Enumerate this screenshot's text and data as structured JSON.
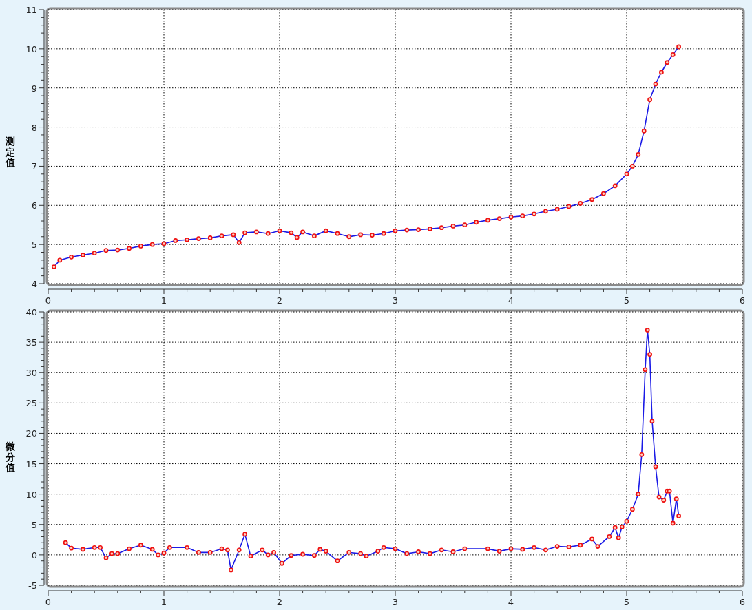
{
  "charts": [
    {
      "chart_data": {
        "type": "line",
        "grid": true,
        "ylabel": "测定值",
        "xlim": [
          0,
          6
        ],
        "ylim": [
          4,
          11
        ],
        "xticks": [
          0,
          1,
          2,
          3,
          4,
          5,
          6
        ],
        "yticks": [
          4,
          5,
          6,
          7,
          8,
          9,
          10,
          11
        ],
        "x": [
          0.05,
          0.1,
          0.2,
          0.3,
          0.4,
          0.5,
          0.6,
          0.7,
          0.8,
          0.9,
          1.0,
          1.1,
          1.2,
          1.3,
          1.4,
          1.5,
          1.6,
          1.65,
          1.7,
          1.8,
          1.9,
          2.0,
          2.1,
          2.15,
          2.2,
          2.3,
          2.4,
          2.5,
          2.6,
          2.7,
          2.8,
          2.9,
          3.0,
          3.1,
          3.2,
          3.3,
          3.4,
          3.5,
          3.6,
          3.7,
          3.8,
          3.9,
          4.0,
          4.1,
          4.2,
          4.3,
          4.4,
          4.5,
          4.6,
          4.7,
          4.8,
          4.9,
          5.0,
          5.05,
          5.1,
          5.15,
          5.2,
          5.25,
          5.3,
          5.35,
          5.4,
          5.45
        ],
        "series": [
          {
            "color": "#1a1ae6",
            "marker": "circle",
            "values": [
              4.43,
              4.6,
              4.68,
              4.73,
              4.78,
              4.85,
              4.86,
              4.9,
              4.96,
              5.0,
              5.02,
              5.1,
              5.12,
              5.15,
              5.17,
              5.22,
              5.25,
              5.05,
              5.3,
              5.32,
              5.28,
              5.35,
              5.3,
              5.18,
              5.32,
              5.22,
              5.35,
              5.28,
              5.2,
              5.25,
              5.24,
              5.28,
              5.35,
              5.37,
              5.38,
              5.4,
              5.43,
              5.47,
              5.5,
              5.57,
              5.62,
              5.66,
              5.7,
              5.73,
              5.78,
              5.85,
              5.9,
              5.97,
              6.05,
              6.15,
              6.3,
              6.5,
              6.8,
              7.0,
              7.3,
              7.9,
              8.7,
              9.1,
              9.4,
              9.65,
              9.85,
              10.05
            ]
          }
        ]
      }
    },
    {
      "chart_data": {
        "type": "line",
        "grid": true,
        "ylabel": "微分值",
        "xlim": [
          0,
          6
        ],
        "ylim": [
          -5,
          40
        ],
        "xticks": [
          0,
          1,
          2,
          3,
          4,
          5,
          6
        ],
        "yticks": [
          -5,
          0,
          5,
          10,
          15,
          20,
          25,
          30,
          35,
          40
        ],
        "x": [
          0.15,
          0.2,
          0.3,
          0.4,
          0.45,
          0.5,
          0.55,
          0.6,
          0.7,
          0.8,
          0.9,
          0.95,
          1.0,
          1.05,
          1.2,
          1.3,
          1.4,
          1.5,
          1.55,
          1.58,
          1.65,
          1.7,
          1.75,
          1.85,
          1.9,
          1.95,
          2.02,
          2.1,
          2.2,
          2.3,
          2.35,
          2.4,
          2.5,
          2.6,
          2.7,
          2.75,
          2.85,
          2.9,
          3.0,
          3.1,
          3.2,
          3.3,
          3.4,
          3.5,
          3.6,
          3.8,
          3.9,
          4.0,
          4.1,
          4.2,
          4.3,
          4.4,
          4.5,
          4.6,
          4.7,
          4.75,
          4.85,
          4.9,
          4.93,
          4.96,
          5.0,
          5.05,
          5.1,
          5.13,
          5.16,
          5.18,
          5.2,
          5.22,
          5.25,
          5.28,
          5.32,
          5.35,
          5.37,
          5.4,
          5.43,
          5.45
        ],
        "series": [
          {
            "color": "#1a1ae6",
            "marker": "circle",
            "values": [
              2.0,
              1.1,
              0.9,
              1.2,
              1.2,
              -0.5,
              0.2,
              0.2,
              1.0,
              1.6,
              0.9,
              0.0,
              0.3,
              1.2,
              1.2,
              0.4,
              0.4,
              1.0,
              0.8,
              -2.5,
              0.8,
              3.4,
              -0.2,
              0.8,
              0.0,
              0.4,
              -1.4,
              -0.1,
              0.1,
              -0.1,
              0.9,
              0.6,
              -1.0,
              0.4,
              0.2,
              -0.2,
              0.6,
              1.2,
              1.0,
              0.2,
              0.5,
              0.2,
              0.8,
              0.5,
              1.0,
              1.0,
              0.6,
              1.0,
              0.9,
              1.2,
              0.8,
              1.4,
              1.3,
              1.6,
              2.6,
              1.4,
              3.0,
              4.5,
              2.8,
              4.6,
              5.5,
              7.5,
              10.0,
              16.5,
              30.5,
              37.0,
              33.0,
              22.0,
              14.5,
              9.5,
              9.0,
              10.5,
              10.5,
              5.2,
              9.2,
              6.4
            ]
          }
        ]
      }
    }
  ]
}
